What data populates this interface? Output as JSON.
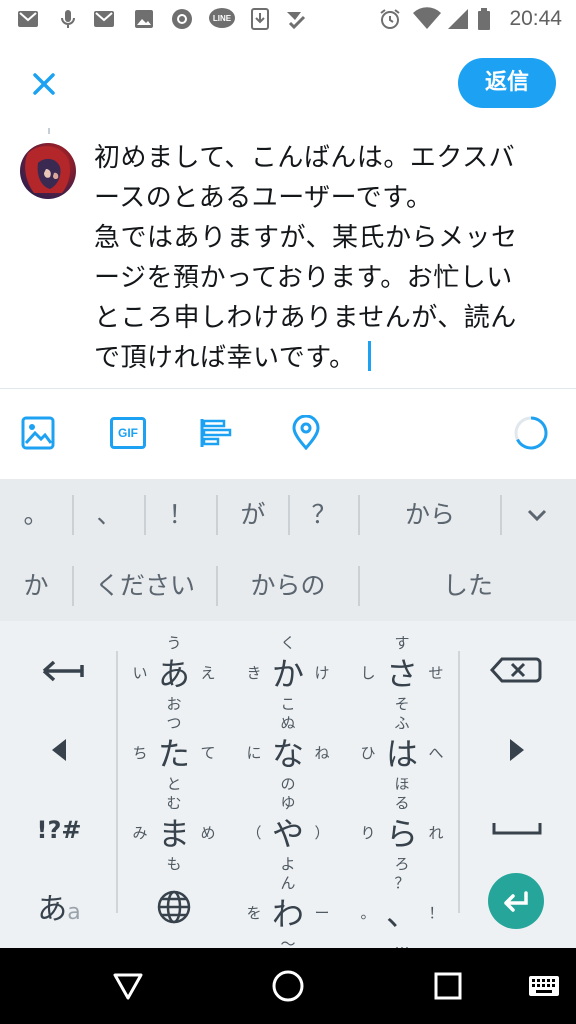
{
  "status_bar": {
    "time": "20:44",
    "left_icons": [
      "gmail-icon",
      "mic-icon",
      "gmail-icon",
      "image-icon",
      "app-icon",
      "line-icon",
      "download-icon",
      "check-icon"
    ],
    "right_icons": [
      "alarm-icon",
      "wifi-icon",
      "signal-icon",
      "battery-icon"
    ]
  },
  "header": {
    "close_icon": "close-icon",
    "reply_label": "返信"
  },
  "compose": {
    "lines": [
      "初めまして、こんばんは。エクスバ",
      "ースのとあるユーザーです。",
      "急ではありますが、某氏からメッセ",
      "ージを預かっております。お忙しい",
      "ところ申しわけありませんが、読ん",
      "で頂ければ幸いです。"
    ]
  },
  "toolbar": {
    "gif_label": "GIF",
    "icons": [
      "image-icon",
      "gif-icon",
      "poll-icon",
      "location-icon",
      "character-counter-icon"
    ]
  },
  "suggestions": {
    "row1": [
      "。",
      "、",
      "！",
      "が",
      "？",
      "から"
    ],
    "row2": [
      "か",
      "ください",
      "からの",
      "した"
    ]
  },
  "keyboard": {
    "rows": [
      [
        {
          "main": "あ",
          "top": "う",
          "bottom": "お",
          "left": "い",
          "right": "え"
        },
        {
          "main": "か",
          "top": "く",
          "bottom": "こ",
          "left": "き",
          "right": "け"
        },
        {
          "main": "さ",
          "top": "す",
          "bottom": "そ",
          "left": "し",
          "right": "せ"
        }
      ],
      [
        {
          "main": "た",
          "top": "つ",
          "bottom": "と",
          "left": "ち",
          "right": "て"
        },
        {
          "main": "な",
          "top": "ぬ",
          "bottom": "の",
          "left": "に",
          "right": "ね"
        },
        {
          "main": "は",
          "top": "ふ",
          "bottom": "ほ",
          "left": "ひ",
          "right": "へ"
        }
      ],
      [
        {
          "main": "ま",
          "top": "む",
          "bottom": "も",
          "left": "み",
          "right": "め"
        },
        {
          "main": "や",
          "top": "ゆ",
          "bottom": "よ",
          "left": "（",
          "right": "）"
        },
        {
          "main": "ら",
          "top": "る",
          "bottom": "ろ",
          "left": "り",
          "right": "れ"
        }
      ],
      [
        {
          "main": "",
          "top": "",
          "bottom": "",
          "left": "",
          "right": ""
        },
        {
          "main": "わ",
          "top": "ん",
          "bottom": "〜",
          "left": "を",
          "right": "ー"
        },
        {
          "main": "、",
          "top": "？",
          "bottom": "…",
          "left": "。",
          "right": "！"
        }
      ]
    ],
    "symbols_label": "!?#",
    "mode_label_main": "あ",
    "mode_label_sub": "a"
  },
  "colors": {
    "accent": "#1da1f2",
    "enter": "#26a69a",
    "suggest_bg": "#e8ebee",
    "keyboard_bg": "#eef1f3"
  }
}
